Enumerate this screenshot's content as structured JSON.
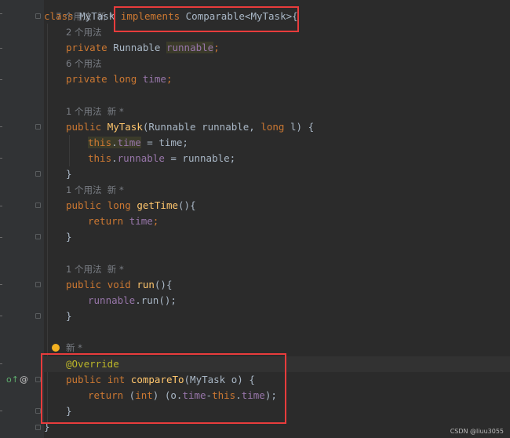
{
  "editor": {
    "hints": {
      "top": "7 个用法  新 *",
      "runnable_usages": "2 个用法",
      "time_usages": "6 个用法",
      "ctor_usages": "1 个用法  新 *",
      "gettime_usages": "1 个用法  新 *",
      "run_usages": "1 个用法  新 *",
      "compareto_new": "新 *"
    },
    "code": {
      "class_kw": "class",
      "class_name": "MyTask",
      "implements_kw": "implements",
      "iface": "Comparable<MyTask>{",
      "private1": "private",
      "runnable_type": "Runnable",
      "runnable_field": "runnable",
      "semi": ";",
      "private2": "private",
      "long1": "long",
      "time_field": "time",
      "public1": "public",
      "ctor_name": "MyTask",
      "ctor_params_a": "(Runnable runnable, ",
      "long2": "long",
      "ctor_params_b": " l) {",
      "this1": "this",
      "dot_time1": "time",
      "assign_time": " = time;",
      "this2": "this",
      "dot_runnable": "runnable",
      "assign_runnable": " = runnable;",
      "close_brace": "}",
      "public2": "public",
      "long3": "long",
      "gettime_name": "getTime",
      "paren_open_brace": "(){",
      "return1": "return",
      "return_time": "time",
      "public3": "public",
      "void_kw": "void",
      "run_name": "run",
      "runnable_call_field": "runnable",
      "runnable_call_rest": ".run();",
      "override": "@Override",
      "public4": "public",
      "int_kw": "int",
      "compareto_name": "compareTo",
      "compareto_params": "(MyTask o) {",
      "return2": "return",
      "cast_open": " (",
      "int_kw2": "int",
      "cast_close": ") (o.",
      "o_time": "time",
      "minus": "-",
      "this3": "this",
      "dot": ".",
      "this_time": "time",
      "end_stmt": ");",
      "class_close": "}"
    },
    "gutter_icons": {
      "implements_marker": "o↑",
      "override_marker": "@"
    }
  },
  "watermark": "CSDN @liuu3055"
}
